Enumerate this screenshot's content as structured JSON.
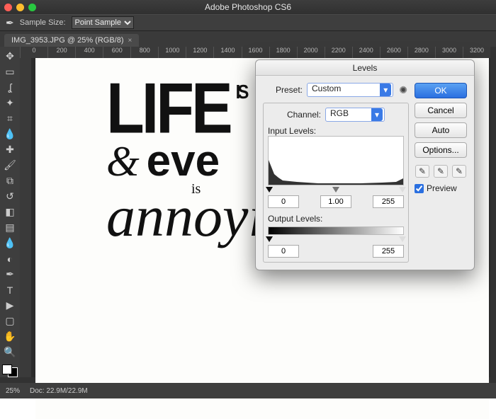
{
  "app": {
    "title": "Adobe Photoshop CS6"
  },
  "options_bar": {
    "sample_size_label": "Sample Size:",
    "sample_size_value": "Point Sample"
  },
  "document": {
    "tab_label": "IMG_3953.JPG @ 25% (RGB/8)",
    "close_glyph": "×"
  },
  "ruler_ticks": [
    "0",
    "200",
    "400",
    "600",
    "800",
    "1000",
    "1200",
    "1400",
    "1600",
    "1800",
    "2000",
    "2200",
    "2400",
    "2600",
    "2800",
    "3000",
    "3200"
  ],
  "tools": [
    {
      "name": "move-tool",
      "glyph": "✥"
    },
    {
      "name": "marquee-tool",
      "glyph": "▭"
    },
    {
      "name": "lasso-tool",
      "glyph": "ʆ"
    },
    {
      "name": "magic-wand-tool",
      "glyph": "✦"
    },
    {
      "name": "crop-tool",
      "glyph": "⌗"
    },
    {
      "name": "eyedropper-tool",
      "glyph": "💧"
    },
    {
      "name": "spot-heal-tool",
      "glyph": "✚"
    },
    {
      "name": "brush-tool",
      "glyph": "🖌"
    },
    {
      "name": "clone-stamp-tool",
      "glyph": "⧉"
    },
    {
      "name": "history-brush-tool",
      "glyph": "↺"
    },
    {
      "name": "eraser-tool",
      "glyph": "◧"
    },
    {
      "name": "gradient-tool",
      "glyph": "▤"
    },
    {
      "name": "blur-tool",
      "glyph": "💧"
    },
    {
      "name": "dodge-tool",
      "glyph": "◐"
    },
    {
      "name": "pen-tool",
      "glyph": "✒"
    },
    {
      "name": "type-tool",
      "glyph": "T"
    },
    {
      "name": "path-select-tool",
      "glyph": "▶"
    },
    {
      "name": "shape-tool",
      "glyph": "▢"
    },
    {
      "name": "hand-tool",
      "glyph": "✋"
    },
    {
      "name": "zoom-tool",
      "glyph": "🔍"
    }
  ],
  "artwork": {
    "line1_main": "LIFE",
    "line1_side": "IS",
    "line2_amp": "&",
    "line2_main": "eve",
    "line2_side": "is",
    "script": "annoying"
  },
  "status": {
    "zoom": "25%",
    "docsize": "Doc: 22.9M/22.9M"
  },
  "levels": {
    "title": "Levels",
    "preset_label": "Preset:",
    "preset_value": "Custom",
    "channel_label": "Channel:",
    "channel_value": "RGB",
    "input_label": "Input Levels:",
    "input_black": "0",
    "input_gamma": "1.00",
    "input_white": "255",
    "output_label": "Output Levels:",
    "output_black": "0",
    "output_white": "255",
    "buttons": {
      "ok": "OK",
      "cancel": "Cancel",
      "auto": "Auto",
      "options": "Options..."
    },
    "preview_label": "Preview",
    "preview_checked": true
  }
}
